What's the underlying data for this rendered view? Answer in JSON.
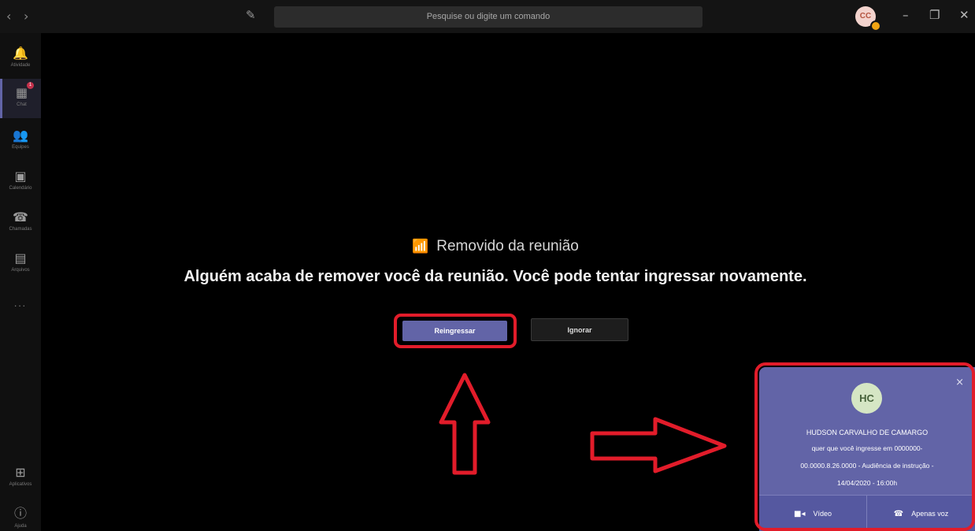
{
  "titlebar": {
    "back": "‹",
    "forward": "›",
    "compose_icon": "compose-icon",
    "search_placeholder": "Pesquise ou digite um comando",
    "avatar_initials": "CC",
    "minimize": "–",
    "maximize": "❐",
    "close": "✕"
  },
  "sidebar": {
    "items": [
      {
        "icon": "bell-icon",
        "glyph": "🔔",
        "label": "Atividade"
      },
      {
        "icon": "chat-icon",
        "glyph": "▦",
        "label": "Chat",
        "badge": "1"
      },
      {
        "icon": "teams-icon",
        "glyph": "👥",
        "label": "Equipes"
      },
      {
        "icon": "calendar-icon",
        "glyph": "▣",
        "label": "Calendário"
      },
      {
        "icon": "phone-icon",
        "glyph": "☎",
        "label": "Chamadas"
      },
      {
        "icon": "files-icon",
        "glyph": "▤",
        "label": "Arquivos"
      }
    ],
    "more": "...",
    "bottom": [
      {
        "icon": "apps-icon",
        "glyph": "⊞",
        "label": "Aplicativos"
      },
      {
        "icon": "help-icon",
        "glyph": "ⓘ",
        "label": "Ajuda"
      }
    ]
  },
  "main": {
    "removed_title": "Removido da reunião",
    "message": "Alguém acaba de remover você da reunião. Você pode tentar ingressar novamente.",
    "rejoin_label": "Reingressar",
    "ignore_label": "Ignorar"
  },
  "toast": {
    "avatar_initials": "HC",
    "close": "×",
    "name": "HUDSON CARVALHO DE CAMARGO",
    "line1": "quer que você ingresse em 0000000-",
    "line2": "00.0000.8.26.0000 - Audiência de instrução -",
    "line3": "14/04/2020 - 16:00h",
    "video_label": "Vídeo",
    "audio_label": "Apenas voz"
  },
  "colors": {
    "accent": "#6264a7",
    "annotation": "#e21c2a",
    "background": "#000000"
  }
}
